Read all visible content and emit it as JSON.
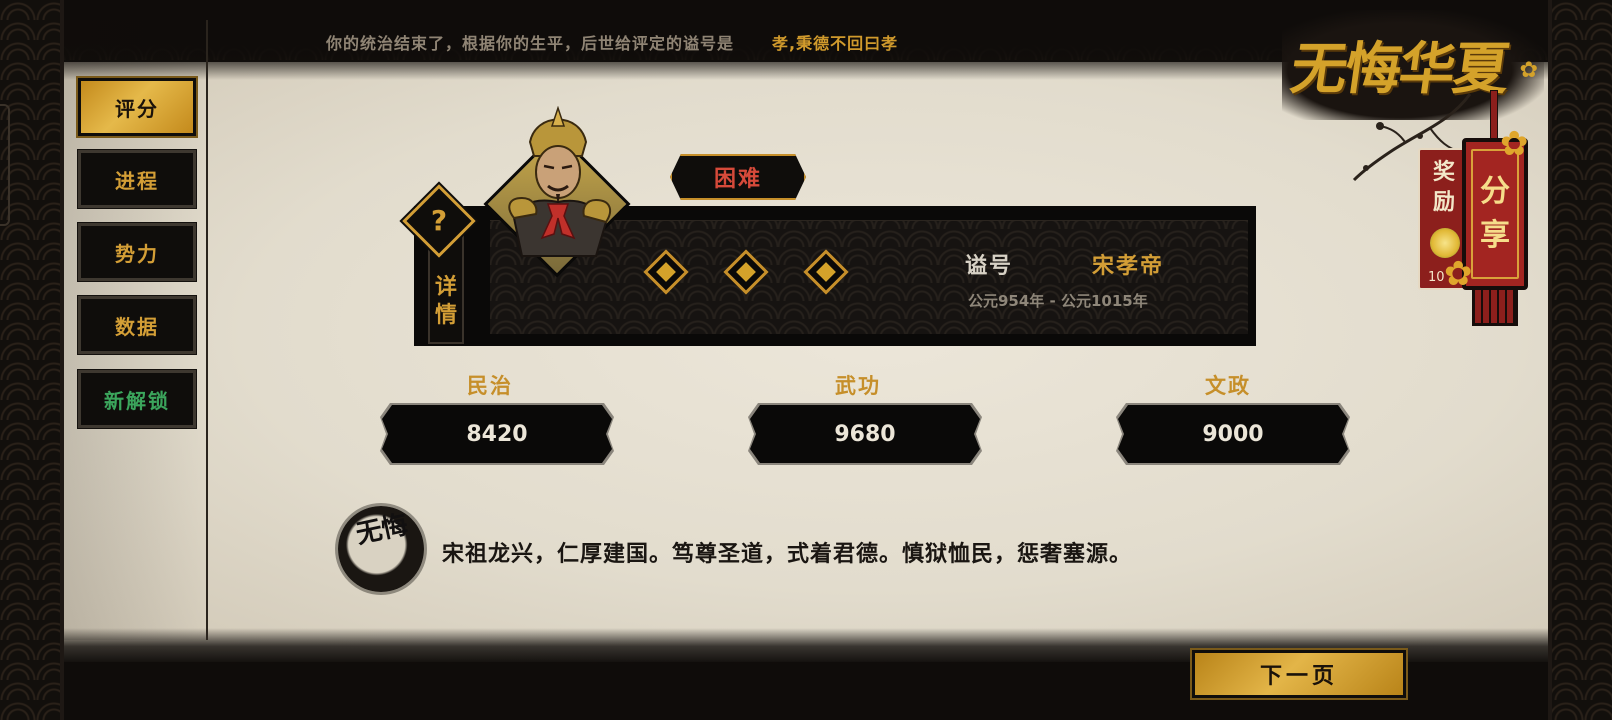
{
  "banner": {
    "intro": "你的统治结束了，根据你的生平，后世给评定的谥号是",
    "posthumous_title": "孝,秉德不回曰孝"
  },
  "nav": {
    "tabs": [
      {
        "label": "评分",
        "active": true
      },
      {
        "label": "进程",
        "active": false
      },
      {
        "label": "势力",
        "active": false
      },
      {
        "label": "数据",
        "active": false
      },
      {
        "label": "新解锁",
        "active": false
      }
    ]
  },
  "logo": {
    "text": "无悔华夏"
  },
  "reward": {
    "label": "奖励",
    "count": "10"
  },
  "share": {
    "label": "分享"
  },
  "card": {
    "difficulty": "困难",
    "help_mark": "?",
    "detail_label": "详情",
    "title_label": "谥号",
    "title_value": "宋孝帝",
    "reign": "公元954年 - 公元1015年"
  },
  "stats": [
    {
      "label": "民治",
      "value": "8420"
    },
    {
      "label": "武功",
      "value": "9680"
    },
    {
      "label": "文政",
      "value": "9000"
    }
  ],
  "seal": {
    "text": "无悔"
  },
  "epitaph": "宋祖龙兴，仁厚建国。笃尊圣道，式着君德。慎狱恤民，惩奢塞源。",
  "next_button": {
    "label": "下一页"
  },
  "colors": {
    "gold": "#d39e36",
    "difficulty_red": "#d64a3a",
    "unlock_green": "#3ba55c",
    "parchment": "#e2dccd",
    "share_red": "#a32521"
  }
}
